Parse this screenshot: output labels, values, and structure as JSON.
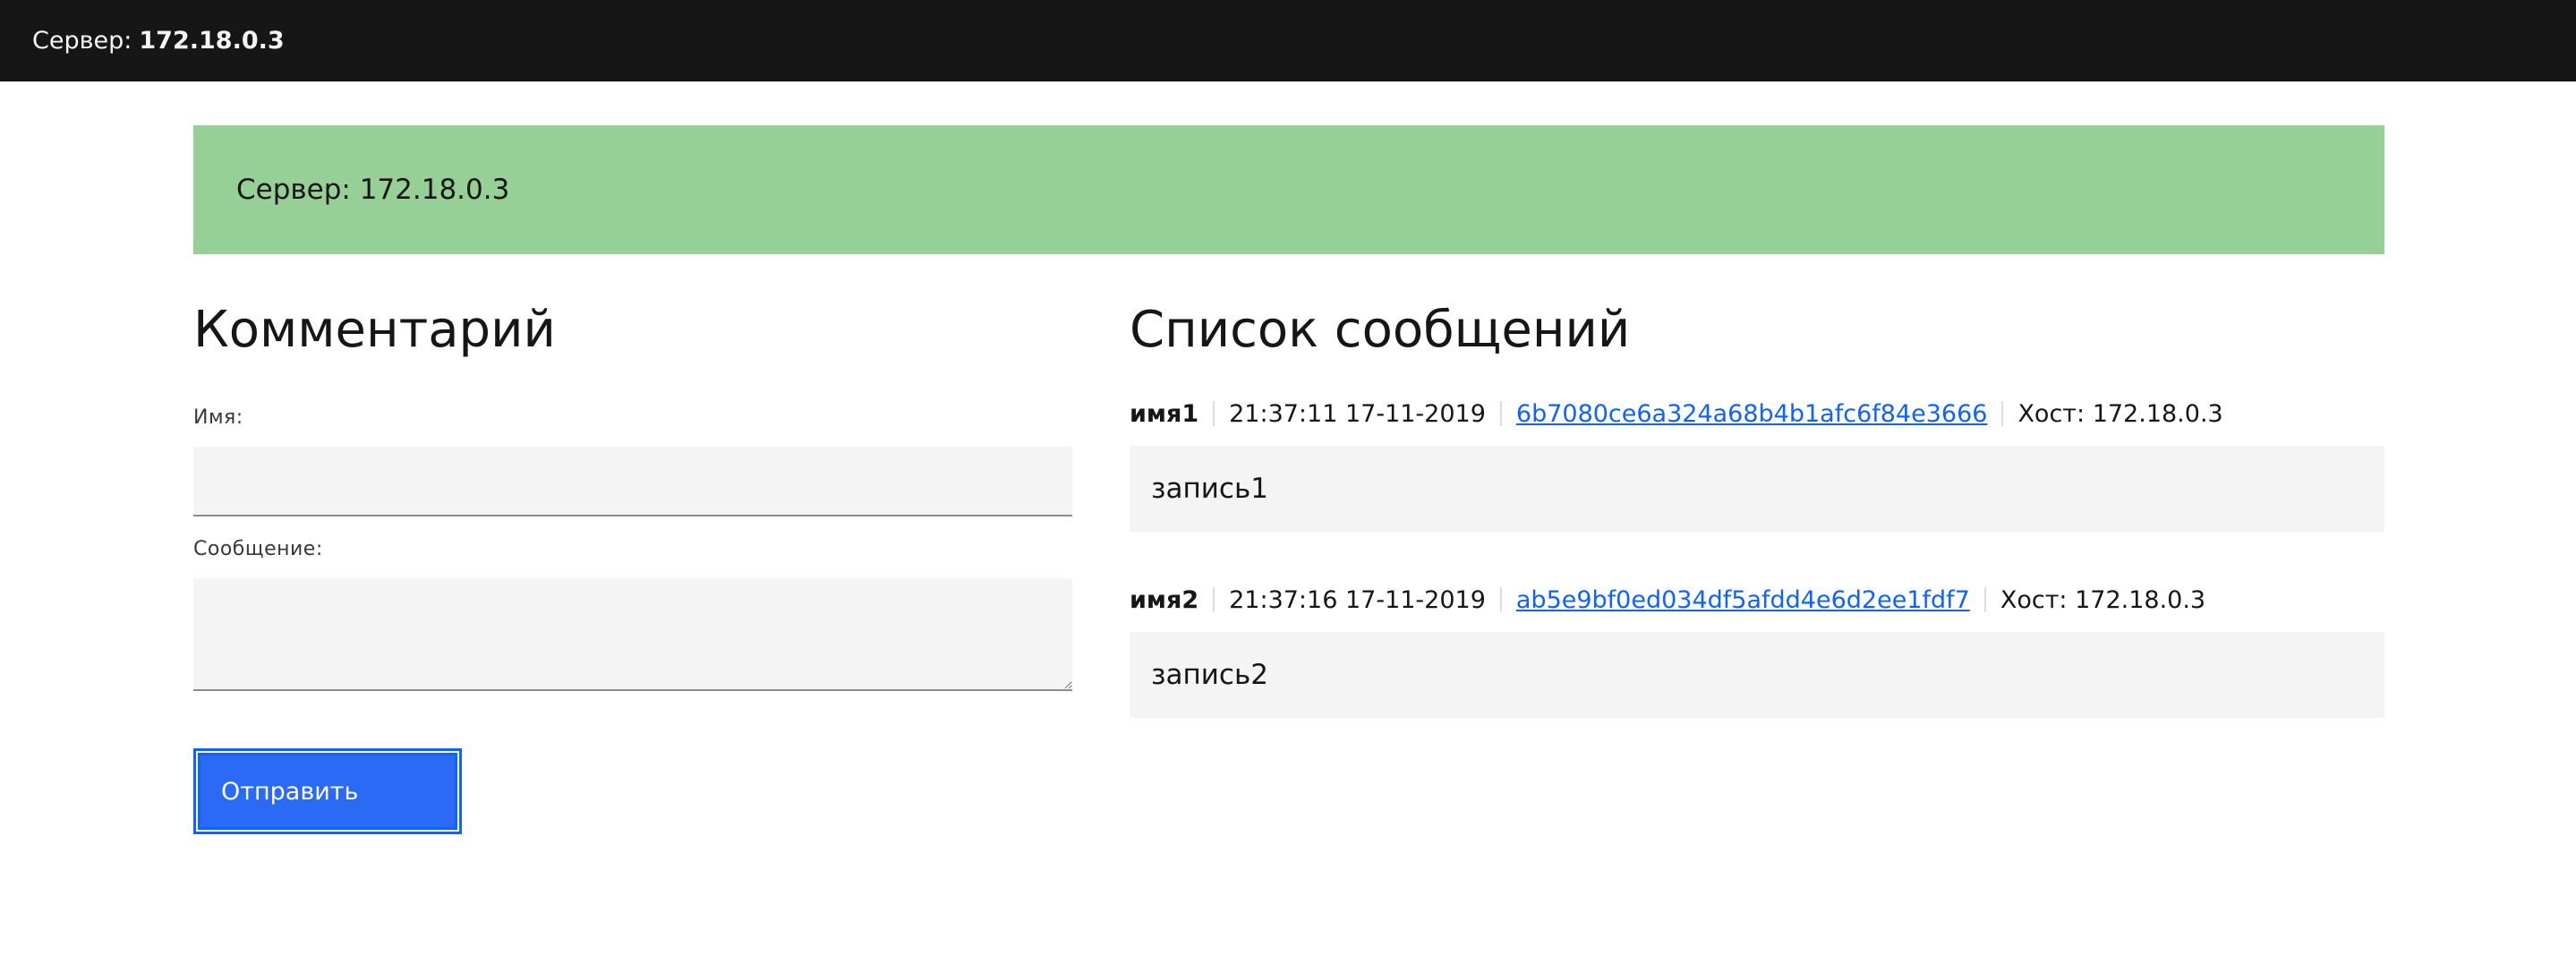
{
  "topbar": {
    "server_label": "Сервер:",
    "server_ip": "172.18.0.3"
  },
  "banner": {
    "text": "Сервер: 172.18.0.3"
  },
  "comment_form": {
    "title": "Комментарий",
    "name_label": "Имя:",
    "name_value": "",
    "message_label": "Сообщение:",
    "message_value": "",
    "submit_label": "Отправить"
  },
  "messages": {
    "title": "Список сообщений",
    "items": [
      {
        "name": "имя1",
        "timestamp": "21:37:11 17-11-2019",
        "id": "6b7080ce6a324a68b4b1afc6f84e3666",
        "host": "Хост: 172.18.0.3",
        "text": "запись1"
      },
      {
        "name": "имя2",
        "timestamp": "21:37:16 17-11-2019",
        "id": "ab5e9bf0ed034df5afdd4e6d2ee1fdf7",
        "host": "Хост: 172.18.0.3",
        "text": "запись2"
      }
    ]
  },
  "colors": {
    "topbar_bg": "#161616",
    "banner_bg": "#97d097",
    "accent": "#0f62fe",
    "field_bg": "#f4f4f4"
  }
}
